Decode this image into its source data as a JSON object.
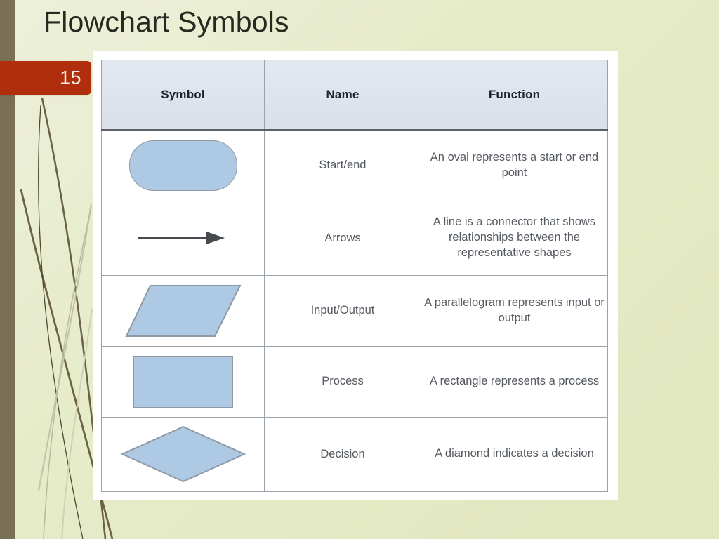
{
  "slide": {
    "title": "Flowchart Symbols",
    "number": "15",
    "background_color": "#e4e9c7",
    "accent_color": "#b02e0c",
    "band_color": "#7a7055"
  },
  "table": {
    "headers": [
      "Symbol",
      "Name",
      "Function"
    ],
    "header_background": "#dde3ec",
    "shape_fill": "#aec9e3",
    "shape_stroke": "#8e99a4",
    "rows": [
      {
        "symbol_icon": "stadium-shape-icon",
        "name": "Start/end",
        "function": "An oval represents a start or end point"
      },
      {
        "symbol_icon": "arrow-right-icon",
        "name": "Arrows",
        "function": "A line is a connector that shows relationships between the representative shapes"
      },
      {
        "symbol_icon": "parallelogram-shape-icon",
        "name": "Input/Output",
        "function": "A parallelogram represents input or output"
      },
      {
        "symbol_icon": "rectangle-shape-icon",
        "name": "Process",
        "function": "A rectangle represents a process"
      },
      {
        "symbol_icon": "diamond-shape-icon",
        "name": "Decision",
        "function": "A diamond indicates a decision"
      }
    ]
  }
}
